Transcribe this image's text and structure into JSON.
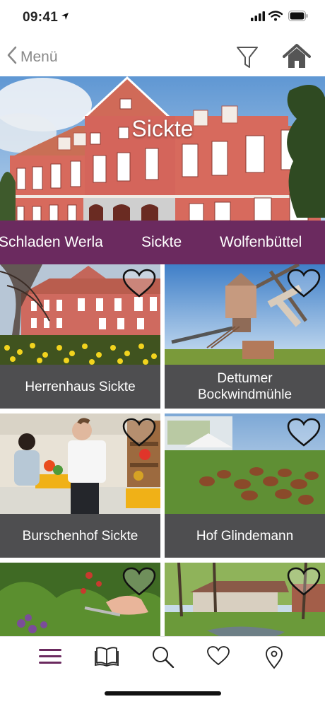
{
  "status_bar": {
    "time": "09:41",
    "icons": [
      "location-arrow-icon",
      "cellular-signal-icon",
      "wifi-icon",
      "battery-icon"
    ]
  },
  "nav": {
    "back_label": "Menü",
    "icons": [
      "chevron-left-icon",
      "filter-icon",
      "home-icon"
    ]
  },
  "hero": {
    "title": "Sickte"
  },
  "places": [
    "Schladen Werla",
    "Sickte",
    "Wolfenbüttel"
  ],
  "tiles": [
    {
      "title": "Herrenhaus Sickte",
      "favorite": false
    },
    {
      "title": "Dettumer Bockwindmühle",
      "favorite": false
    },
    {
      "title": "Burschenhof Sickte",
      "favorite": false
    },
    {
      "title": "Hof Glindemann",
      "favorite": false
    },
    {
      "title": "",
      "favorite": false
    },
    {
      "title": "",
      "favorite": false
    }
  ],
  "tab_bar": {
    "items": [
      "menu-icon",
      "book-icon",
      "search-icon",
      "heart-icon",
      "map-pin-icon"
    ],
    "active": "menu-icon"
  },
  "colors": {
    "accent": "#6b2a5f",
    "caption_bg": "#4e4e50",
    "nav_gray": "#888888"
  }
}
